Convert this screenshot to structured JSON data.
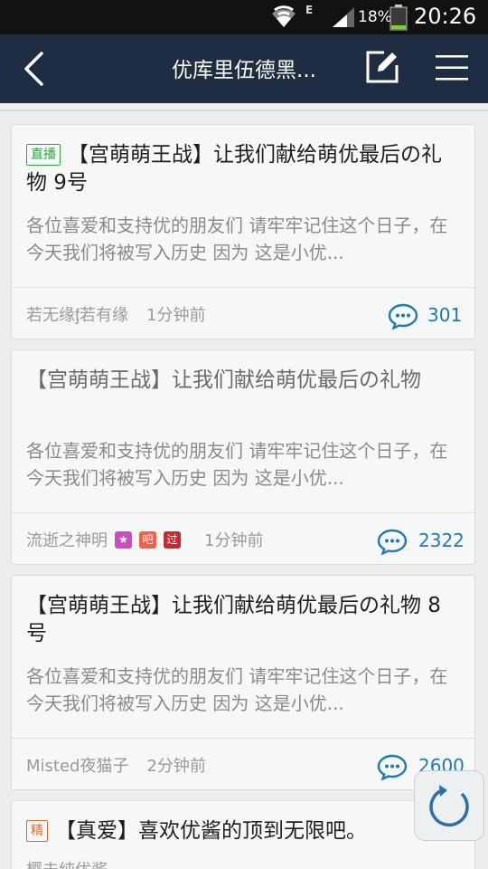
{
  "status_bar": {
    "network_type": "E",
    "battery_percent": "18%",
    "time": "20:26"
  },
  "nav": {
    "title": "优库里伍德黑..."
  },
  "posts": [
    {
      "tag": "直播",
      "title": "【宫萌萌王战】让我们献给萌优最后の礼物 9号",
      "excerpt": "各位喜爱和支持优的朋友们 请牢牢记住这个日子，在今天我们将被写入历史 因为 这是小优...",
      "author": "若无缘ᶂ若有缘",
      "time": "1分钟前",
      "replies": "301"
    },
    {
      "title": "【宫萌萌王战】让我们献给萌优最后の礼物",
      "excerpt": "各位喜爱和支持优的朋友们 请牢牢记住这个日子，在今天我们将被写入历史 因为 这是小优...",
      "author": "流逝之神明",
      "badges": [
        "★",
        "吧",
        "过"
      ],
      "time": "1分钟前",
      "replies": "2322"
    },
    {
      "title": "【宫萌萌王战】让我们献给萌优最后の礼物 8号",
      "excerpt": "各位喜爱和支持优的朋友们 请牢牢记住这个日子，在今天我们将被写入历史 因为 这是小优...",
      "author": "Misted夜猫子",
      "time": "2分钟前",
      "replies": "2600"
    },
    {
      "tag": "精",
      "title": "【真爱】喜欢优酱的顶到无限吧。",
      "author": "樱未纯优酱"
    }
  ],
  "icons": {
    "back": "chevron-left-icon",
    "compose": "edit-icon",
    "menu": "menu-icon",
    "reply": "comment-bubble-icon",
    "refresh": "refresh-icon"
  },
  "colors": {
    "nav_background": "#1f2d42",
    "live_tag": "#2fa545",
    "elite_tag": "#e06a2c",
    "reply_count": "#2178b6"
  }
}
